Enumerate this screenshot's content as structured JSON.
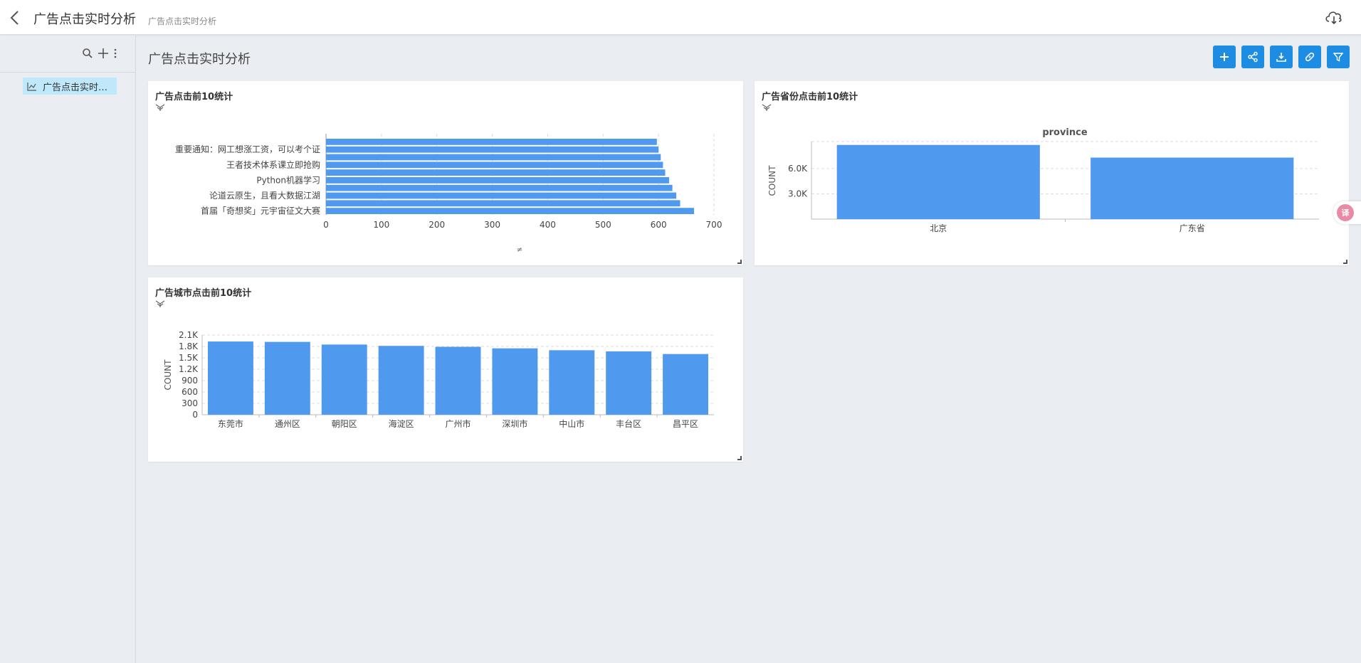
{
  "header": {
    "title": "广告点击实时分析",
    "subtitle": "广告点击实时分析"
  },
  "sidebar": {
    "items": [
      {
        "label": "广告点击实时分析"
      }
    ]
  },
  "main": {
    "title": "广告点击实时分析"
  },
  "colors": {
    "accent": "#1d8de4",
    "bar": "#4f99ee",
    "selected": "#bfe8fb"
  },
  "charts": [
    {
      "title": "广告点击前10统计",
      "chart_data": {
        "type": "bar",
        "orientation": "horizontal",
        "categories": [
          "",
          "",
          "",
          "",
          "",
          "",
          "",
          "",
          "",
          ""
        ],
        "visible_tick_labels": [
          "重要通知：网工想涨工资，可以考个证",
          "王者技术体系课立即抢购",
          "Python机器学习",
          "论道云原生，且看大数据江湖",
          "首届「奇想奖」元宇宙征文大赛"
        ],
        "visible_tick_indices": [
          1,
          3,
          5,
          7,
          9
        ],
        "values": [
          597,
          600,
          604,
          608,
          612,
          619,
          625,
          632,
          639,
          664
        ],
        "xlim": [
          0,
          700
        ],
        "xticks": [
          "0",
          "100",
          "200",
          "300",
          "400",
          "500",
          "600",
          "700"
        ],
        "xlabel": "",
        "ylabel": "",
        "grid": true
      }
    },
    {
      "title": "广告省份点击前10统计",
      "chart_data": {
        "type": "bar",
        "title": "province",
        "categories": [
          "北京",
          "广东省"
        ],
        "values": [
          8800,
          7300
        ],
        "ylim": [
          0,
          9200
        ],
        "yticks": [
          "3.0K",
          "6.0K"
        ],
        "ylabel": "COUNT",
        "xlabel": "",
        "grid": true
      }
    },
    {
      "title": "广告城市点击前10统计",
      "chart_data": {
        "type": "bar",
        "categories": [
          "东莞市",
          "通州区",
          "朝阳区",
          "海淀区",
          "广州市",
          "深圳市",
          "中山市",
          "丰台区",
          "昌平区"
        ],
        "values": [
          1930,
          1920,
          1850,
          1815,
          1790,
          1750,
          1700,
          1670,
          1600
        ],
        "ylim": [
          0,
          2100
        ],
        "yticks": [
          "0",
          "300",
          "600",
          "900",
          "1.2K",
          "1.5K",
          "1.8K",
          "2.1K"
        ],
        "ylabel": "COUNT",
        "xlabel": "",
        "grid": true
      }
    }
  ]
}
